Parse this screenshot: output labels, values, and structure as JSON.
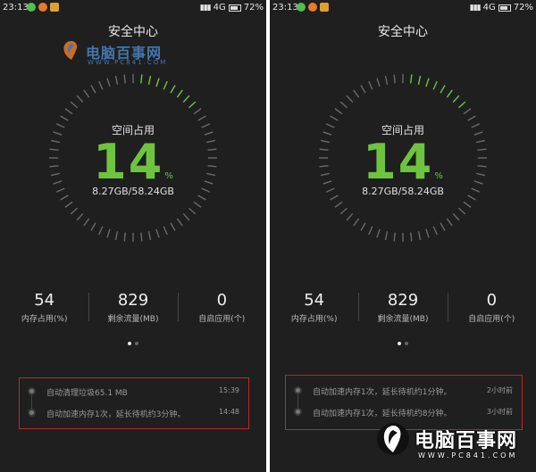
{
  "status_bar": {
    "time": "23:13",
    "network": "4G",
    "signal": "▮▮▮",
    "battery": "72%"
  },
  "title": "安全中心",
  "watermark_top": {
    "text": "电脑百事网",
    "url": "WWW.PC841.COM"
  },
  "storage": {
    "label": "空间占用",
    "percent": 14,
    "percent_text": "14",
    "percent_sign": "%",
    "used_total": "8.27GB/58.24GB"
  },
  "stats": [
    {
      "value": "54",
      "label": "内存占用(%)"
    },
    {
      "value": "829",
      "label": "剩余流量(MB)"
    },
    {
      "value": "0",
      "label": "自启应用(个)"
    }
  ],
  "pager": {
    "count": 2,
    "active": 0
  },
  "logs_left": [
    {
      "text": "自动清理垃圾65.1 MB",
      "time": "15:39"
    },
    {
      "text": "自动加速内存1次，延长待机约3分钟。",
      "time": "14:48"
    }
  ],
  "logs_right": [
    {
      "text": "自动加速内存1次，延长待机约1分钟。",
      "time": "2小时前"
    },
    {
      "text": "自动加速内存1次，延长待机约8分钟。",
      "time": "3小时前"
    }
  ],
  "watermark_bottom": {
    "text": "电脑百事网",
    "url": "WWW.PC841.COM"
  },
  "colors": {
    "background": "#1f1f1f",
    "accent_green": "#6ec43e",
    "highlight_red": "#c0282a",
    "tick_gray": "#6a6a6a"
  }
}
